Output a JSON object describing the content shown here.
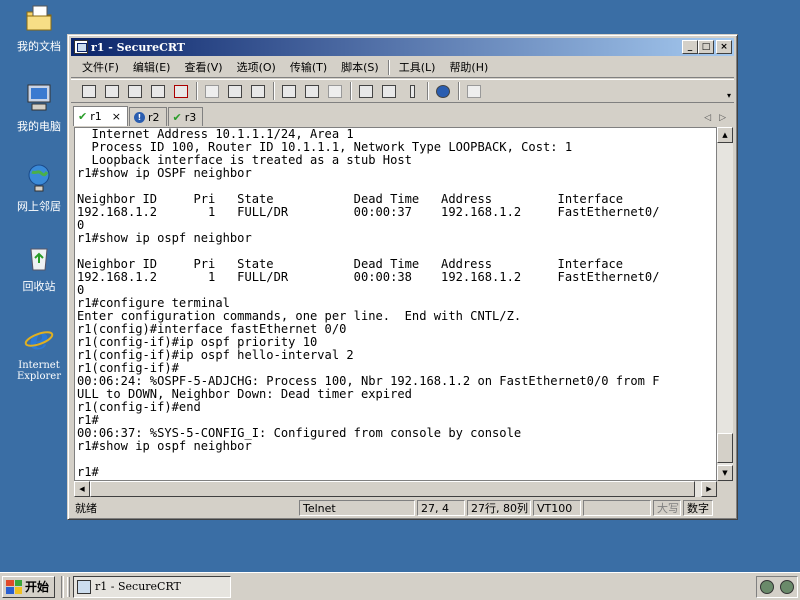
{
  "desktop": {
    "icons": [
      {
        "label": "我的文档",
        "icon": "my-documents-icon"
      },
      {
        "label": "我的电脑",
        "icon": "my-computer-icon"
      },
      {
        "label": "网上邻居",
        "icon": "network-places-icon"
      },
      {
        "label": "回收站",
        "icon": "recycle-bin-icon"
      },
      {
        "label": "Internet Explorer",
        "icon": "internet-explorer-icon"
      }
    ]
  },
  "window": {
    "title": "r1 - SecureCRT",
    "controls": {
      "minimize": "_",
      "maximize": "□",
      "close": "×"
    }
  },
  "menu": [
    "文件(F)",
    "编辑(E)",
    "查看(V)",
    "选项(O)",
    "传输(T)",
    "脚本(S)",
    "工具(L)",
    "帮助(H)"
  ],
  "tabs": [
    {
      "label": "r1",
      "status": "connected",
      "close": "×"
    },
    {
      "label": "r2",
      "status": "info"
    },
    {
      "label": "r3",
      "status": "connected"
    }
  ],
  "terminal": {
    "lines": [
      "  Internet Address 10.1.1.1/24, Area 1",
      "  Process ID 100, Router ID 10.1.1.1, Network Type LOOPBACK, Cost: 1",
      "  Loopback interface is treated as a stub Host",
      "r1#show ip OSPF neighbor",
      "",
      "Neighbor ID     Pri   State           Dead Time   Address         Interface",
      "192.168.1.2       1   FULL/DR         00:00:37    192.168.1.2     FastEthernet0/",
      "0",
      "r1#show ip ospf neighbor",
      "",
      "Neighbor ID     Pri   State           Dead Time   Address         Interface",
      "192.168.1.2       1   FULL/DR         00:00:38    192.168.1.2     FastEthernet0/",
      "0",
      "r1#configure terminal",
      "Enter configuration commands, one per line.  End with CNTL/Z.",
      "r1(config)#interface fastEthernet 0/0",
      "r1(config-if)#ip ospf priority 10",
      "r1(config-if)#ip ospf hello-interval 2",
      "r1(config-if)#",
      "00:06:24: %OSPF-5-ADJCHG: Process 100, Nbr 192.168.1.2 on FastEthernet0/0 from F",
      "ULL to DOWN, Neighbor Down: Dead timer expired",
      "r1(config-if)#end",
      "r1#",
      "00:06:37: %SYS-5-CONFIG_I: Configured from console by console",
      "r1#show ip ospf neighbor",
      "",
      "r1#"
    ]
  },
  "status": {
    "ready": "就绪",
    "protocol": "Telnet",
    "cursor": "27,  4",
    "size": "27行, 80列",
    "emulation": "VT100",
    "caps": "大写",
    "num": "数字"
  },
  "taskbar": {
    "start_label": "开始",
    "task_label": "r1 - SecureCRT"
  }
}
